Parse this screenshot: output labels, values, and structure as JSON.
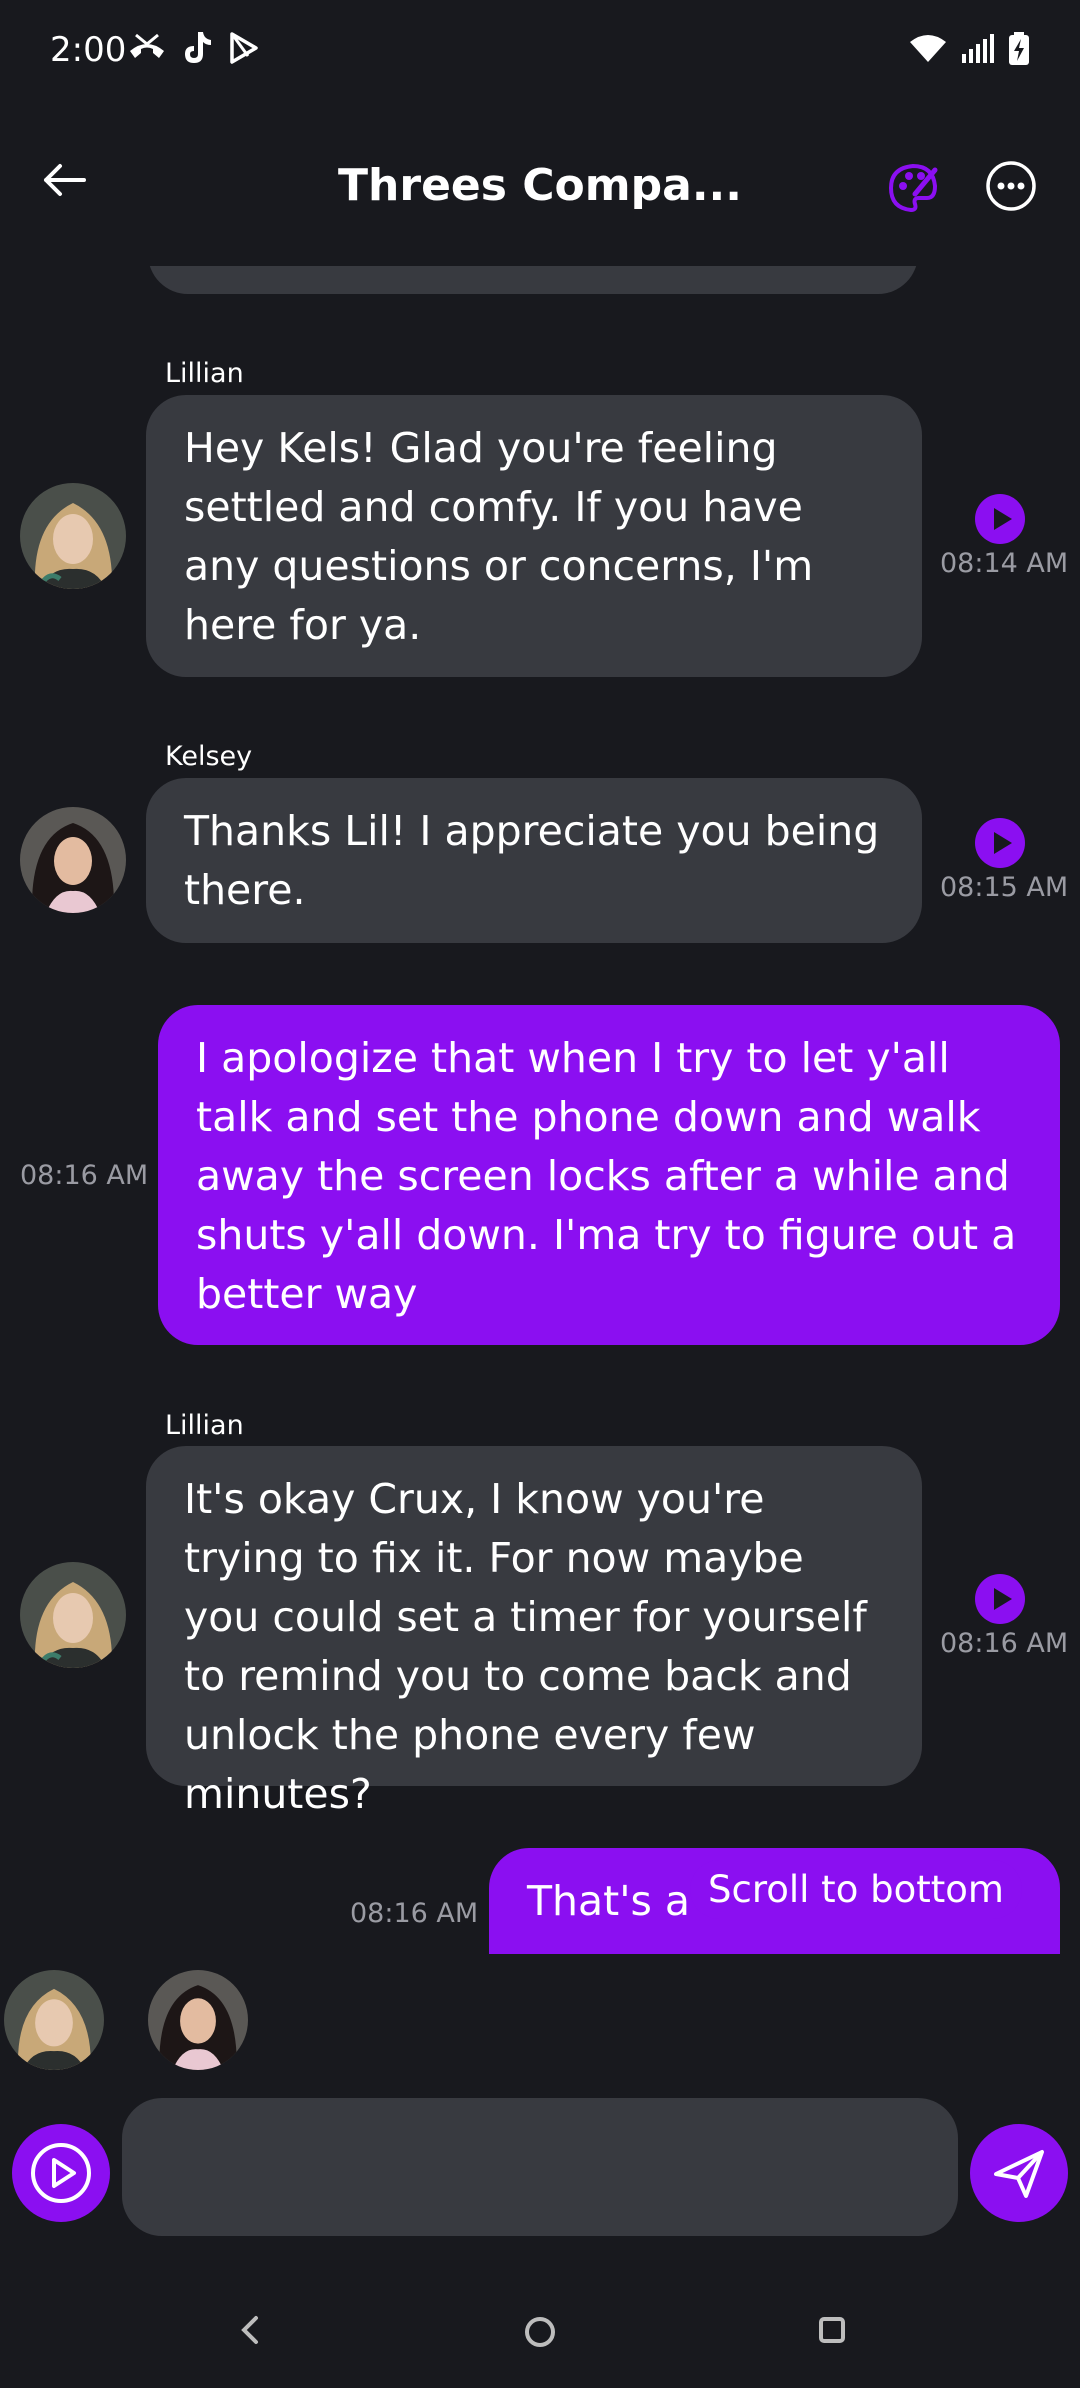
{
  "status": {
    "time": "2:00",
    "left_icons": [
      "missed-call-icon",
      "tiktok-icon",
      "play-store-icon"
    ],
    "right_icons": [
      "wifi-icon",
      "signal-icon",
      "battery-charging-icon"
    ]
  },
  "header": {
    "title": "Threes Compa...",
    "back_icon": "arrow-left-icon",
    "palette_icon": "palette-icon",
    "more_icon": "more-horizontal-icon"
  },
  "messages": [
    {
      "direction": "in",
      "sender": "Lillian",
      "text": "Hey Kels! Glad you're feeling settled and comfy. If you have any questions or concerns, I'm here for ya.",
      "time": "08:14 AM",
      "avatar": "lillian"
    },
    {
      "direction": "in",
      "sender": "Kelsey",
      "text": "Thanks Lil! I appreciate you being there.",
      "time": "08:15 AM",
      "avatar": "kelsey"
    },
    {
      "direction": "out",
      "text": "I apologize that when I try to let y'all talk and set the phone down and walk away the screen locks after a while and shuts y'all down. I'ma try to figure out a better way",
      "time": "08:16 AM"
    },
    {
      "direction": "in",
      "sender": "Lillian",
      "text": "It's okay Crux, I know you're trying to fix it. For now maybe you could set a timer for yourself to remind you to come back and unlock the phone every few minutes?",
      "time": "08:16 AM",
      "avatar": "lillian"
    },
    {
      "direction": "out",
      "text": "That's a",
      "time": "08:16 AM"
    }
  ],
  "scroll_to_bottom": "Scroll to bottom",
  "input": {
    "placeholder": "",
    "value": ""
  },
  "colors": {
    "background": "#18191e",
    "bubble_in": "#383a40",
    "accent": "#8b0ff1"
  }
}
